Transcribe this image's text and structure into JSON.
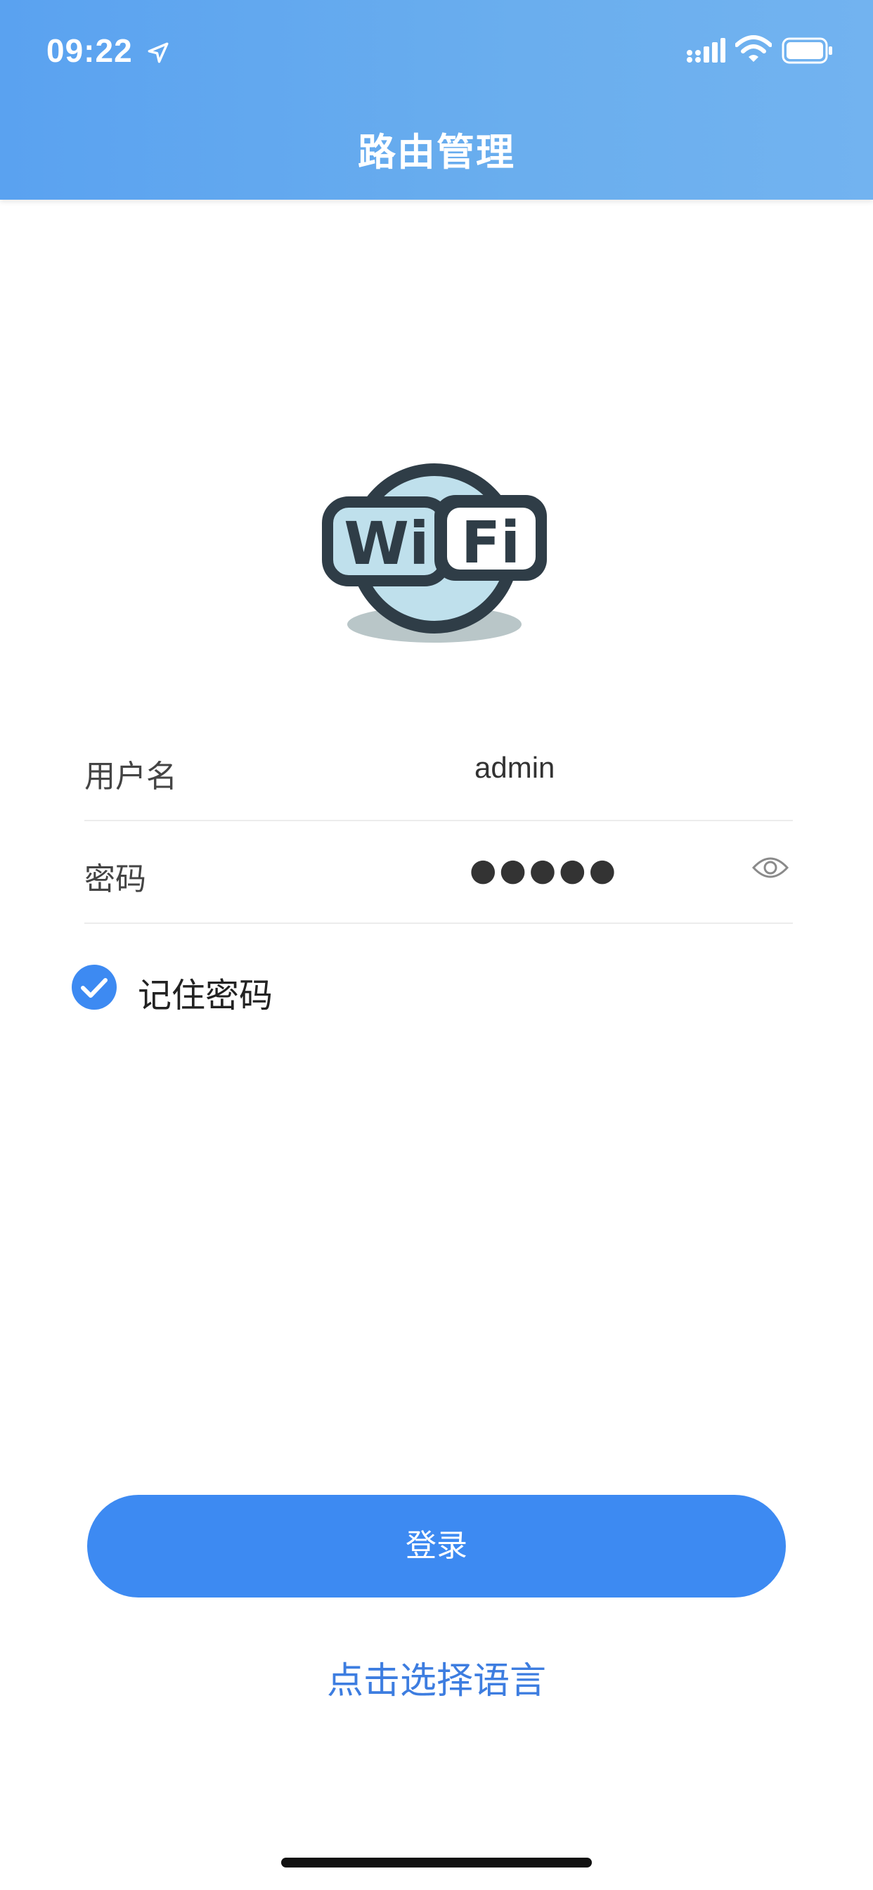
{
  "status_bar": {
    "time": "09:22"
  },
  "header": {
    "title": "路由管理"
  },
  "logo": {
    "text_left": "Wi",
    "text_right": "Fi",
    "colors": {
      "outline": "#2f3d47",
      "fill": "#bfe0ec",
      "shadow": "#b9c6c8"
    }
  },
  "form": {
    "username": {
      "label": "用户名",
      "value": "admin"
    },
    "password": {
      "label": "密码",
      "masked_value": "●●●●●",
      "toggle_icon": "eye-icon"
    },
    "remember": {
      "label": "记住密码",
      "checked": true
    }
  },
  "actions": {
    "login_label": "登录",
    "language_link": "点击选择语言"
  },
  "colors": {
    "header_bg": "#62a8ef",
    "primary": "#3d8af2",
    "link": "#3d7de0"
  }
}
